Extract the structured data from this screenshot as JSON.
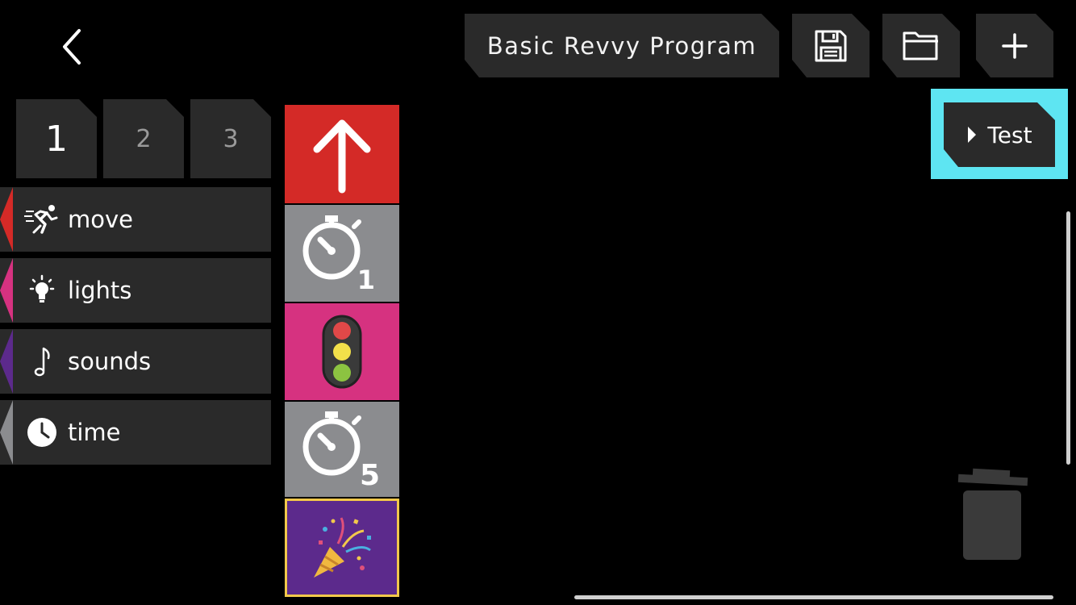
{
  "header": {
    "program_title": "Basic Revvy Program",
    "back_icon": "chevron-left-icon",
    "save_icon": "floppy-disk-icon",
    "open_icon": "folder-icon",
    "new_icon": "plus-icon"
  },
  "page_tabs": [
    {
      "label": "1",
      "active": true
    },
    {
      "label": "2",
      "active": false
    },
    {
      "label": "3",
      "active": false
    }
  ],
  "categories": [
    {
      "label": "move",
      "icon": "running-person-icon",
      "color": "#d42a27"
    },
    {
      "label": "lights",
      "icon": "light-bulb-icon",
      "color": "#d63280"
    },
    {
      "label": "sounds",
      "icon": "music-note-icon",
      "color": "#5c2a8c"
    },
    {
      "label": "time",
      "icon": "clock-icon",
      "color": "#8b8c8f"
    }
  ],
  "blocks": [
    {
      "type": "move-forward",
      "icon": "up-arrow-icon",
      "color": "#d42a27"
    },
    {
      "type": "wait",
      "icon": "stopwatch-icon",
      "value": "1",
      "color": "#8b8c8f"
    },
    {
      "type": "lights",
      "icon": "traffic-light-icon",
      "color": "#d63280"
    },
    {
      "type": "wait",
      "icon": "stopwatch-icon",
      "value": "5",
      "color": "#8b8c8f"
    },
    {
      "type": "sound",
      "icon": "party-popper-icon",
      "color": "#5c2a8c"
    }
  ],
  "test_button": {
    "label": "Test",
    "icon": "play-triangle-icon",
    "highlight_color": "#5ee5f2"
  },
  "trash": {
    "icon": "trash-can-icon"
  },
  "colors": {
    "background": "#000000",
    "panel": "#2a2a2a"
  }
}
